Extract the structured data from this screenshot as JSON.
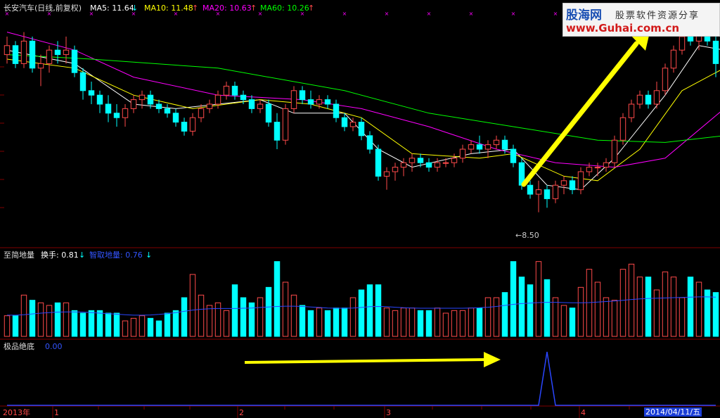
{
  "header": {
    "title": "长安汽车(日线,前复权)",
    "ma5_label": "MA5: 11.64",
    "ma5_arrow": "↓",
    "ma10_label": "MA10: 11.48",
    "ma10_arrow": "↑",
    "ma20_label": "MA20: 10.63",
    "ma20_arrow": "↑",
    "ma60_label": "MA60: 10.26",
    "ma60_arrow": "↑"
  },
  "panel2": {
    "title": "至简地量",
    "turnover_label": "换手: 0.81",
    "turnover_arrow": "↓",
    "smart_label": "智取地量: 0.76",
    "smart_arrow": "↓"
  },
  "panel3": {
    "title": "极品绝底",
    "value": "0.00"
  },
  "watermark": {
    "brand": "股海网",
    "slogan": "股票软件资源分享",
    "url": "www.Guhai.com.cn"
  },
  "low_marker": "8.50",
  "xaxis": {
    "year": "2013年",
    "m1": "1",
    "m2": "2",
    "m3": "3",
    "m4": "4",
    "date_box": "2014/04/11/五"
  },
  "colors": {
    "bg": "#000000",
    "up": "#ff4a4a",
    "down": "#00ffff",
    "ma5": "#ffffff",
    "ma10": "#ffff00",
    "ma20": "#ff00ff",
    "ma60": "#00ff00",
    "arrow": "#ffff00"
  },
  "chart_data": [
    {
      "type": "candlestick",
      "title": "长安汽车(日线,前复权)",
      "ylim": [
        8.0,
        13.0
      ],
      "series_candles": [
        [
          12.1,
          12.5,
          11.9,
          12.3
        ],
        [
          12.3,
          12.4,
          11.8,
          11.9
        ],
        [
          11.9,
          12.6,
          11.8,
          12.4
        ],
        [
          12.4,
          12.5,
          11.7,
          11.8
        ],
        [
          11.8,
          12.1,
          11.4,
          11.9
        ],
        [
          11.9,
          12.3,
          11.7,
          12.2
        ],
        [
          12.2,
          12.4,
          11.9,
          12.1
        ],
        [
          12.1,
          12.5,
          11.9,
          12.2
        ],
        [
          12.2,
          12.3,
          11.6,
          11.7
        ],
        [
          11.7,
          11.8,
          11.1,
          11.3
        ],
        [
          11.3,
          11.5,
          11.0,
          11.2
        ],
        [
          11.2,
          11.3,
          10.8,
          11.0
        ],
        [
          11.0,
          11.2,
          10.6,
          10.8
        ],
        [
          10.8,
          11.0,
          10.5,
          10.7
        ],
        [
          10.7,
          11.0,
          10.5,
          10.9
        ],
        [
          10.9,
          11.2,
          10.8,
          11.1
        ],
        [
          11.1,
          11.3,
          10.9,
          11.2
        ],
        [
          11.2,
          11.3,
          10.9,
          11.0
        ],
        [
          11.0,
          11.1,
          10.8,
          10.9
        ],
        [
          10.9,
          11.0,
          10.7,
          10.8
        ],
        [
          10.8,
          10.9,
          10.5,
          10.6
        ],
        [
          10.6,
          10.7,
          10.3,
          10.4
        ],
        [
          10.4,
          10.8,
          10.3,
          10.7
        ],
        [
          10.7,
          11.0,
          10.6,
          10.9
        ],
        [
          10.9,
          11.1,
          10.8,
          11.0
        ],
        [
          11.0,
          11.3,
          10.9,
          11.2
        ],
        [
          11.2,
          11.5,
          11.1,
          11.4
        ],
        [
          11.4,
          11.5,
          11.1,
          11.2
        ],
        [
          11.2,
          11.3,
          11.0,
          11.1
        ],
        [
          11.1,
          11.2,
          10.8,
          10.9
        ],
        [
          10.9,
          11.1,
          10.8,
          11.0
        ],
        [
          11.0,
          11.1,
          10.5,
          10.6
        ],
        [
          10.6,
          10.8,
          10.0,
          10.2
        ],
        [
          10.2,
          11.0,
          10.1,
          10.9
        ],
        [
          10.9,
          11.4,
          10.8,
          11.3
        ],
        [
          11.3,
          11.4,
          11.0,
          11.1
        ],
        [
          11.1,
          11.3,
          10.9,
          11.0
        ],
        [
          11.0,
          11.2,
          10.9,
          11.1
        ],
        [
          11.1,
          11.2,
          10.9,
          11.0
        ],
        [
          11.0,
          11.1,
          10.6,
          10.7
        ],
        [
          10.7,
          10.8,
          10.4,
          10.5
        ],
        [
          10.5,
          10.7,
          10.4,
          10.6
        ],
        [
          10.6,
          10.7,
          10.2,
          10.3
        ],
        [
          10.3,
          10.4,
          9.9,
          10.0
        ],
        [
          10.0,
          10.1,
          9.3,
          9.4
        ],
        [
          9.4,
          9.6,
          9.1,
          9.5
        ],
        [
          9.5,
          9.7,
          9.3,
          9.6
        ],
        [
          9.6,
          9.8,
          9.4,
          9.7
        ],
        [
          9.7,
          9.9,
          9.5,
          9.8
        ],
        [
          9.8,
          9.9,
          9.6,
          9.7
        ],
        [
          9.7,
          9.8,
          9.5,
          9.6
        ],
        [
          9.6,
          9.8,
          9.5,
          9.7
        ],
        [
          9.7,
          9.8,
          9.6,
          9.7
        ],
        [
          9.7,
          9.9,
          9.6,
          9.8
        ],
        [
          9.8,
          10.1,
          9.7,
          10.0
        ],
        [
          10.0,
          10.2,
          9.9,
          10.1
        ],
        [
          10.1,
          10.3,
          9.9,
          10.0
        ],
        [
          10.0,
          10.2,
          9.8,
          10.1
        ],
        [
          10.1,
          10.3,
          10.0,
          10.2
        ],
        [
          10.2,
          10.3,
          9.9,
          10.0
        ],
        [
          10.0,
          10.1,
          9.6,
          9.7
        ],
        [
          9.7,
          9.8,
          9.1,
          9.2
        ],
        [
          9.2,
          9.3,
          8.9,
          9.0
        ],
        [
          9.0,
          9.3,
          8.6,
          9.1
        ],
        [
          9.1,
          9.2,
          8.7,
          8.9
        ],
        [
          8.9,
          9.3,
          8.8,
          9.2
        ],
        [
          9.2,
          9.4,
          9.0,
          9.3
        ],
        [
          9.3,
          9.4,
          9.0,
          9.1
        ],
        [
          9.1,
          9.6,
          9.0,
          9.5
        ],
        [
          9.5,
          9.7,
          9.4,
          9.6
        ],
        [
          9.6,
          9.7,
          9.4,
          9.6
        ],
        [
          9.6,
          9.8,
          9.5,
          9.7
        ],
        [
          9.7,
          10.3,
          9.6,
          10.2
        ],
        [
          10.2,
          10.8,
          10.1,
          10.7
        ],
        [
          10.7,
          11.1,
          10.6,
          11.0
        ],
        [
          11.0,
          11.3,
          10.9,
          11.2
        ],
        [
          11.2,
          11.3,
          10.9,
          11.0
        ],
        [
          11.0,
          11.5,
          10.9,
          11.3
        ],
        [
          11.3,
          11.9,
          11.2,
          11.8
        ],
        [
          11.8,
          12.3,
          11.7,
          12.2
        ],
        [
          12.2,
          12.6,
          12.1,
          12.5
        ],
        [
          12.5,
          12.9,
          12.3,
          12.4
        ],
        [
          12.4,
          12.8,
          12.2,
          12.6
        ],
        [
          12.6,
          12.8,
          12.3,
          12.4
        ],
        [
          12.4,
          12.6,
          11.6,
          11.9
        ]
      ],
      "ma_series": [
        {
          "name": "MA5",
          "anchors": [
            [
              0,
              12.2
            ],
            [
              8,
              11.9
            ],
            [
              15,
              11.0
            ],
            [
              20,
              10.9
            ],
            [
              25,
              11.0
            ],
            [
              30,
              11.1
            ],
            [
              34,
              10.8
            ],
            [
              40,
              10.8
            ],
            [
              44,
              10.0
            ],
            [
              48,
              9.6
            ],
            [
              55,
              9.9
            ],
            [
              60,
              10.0
            ],
            [
              64,
              9.2
            ],
            [
              68,
              9.1
            ],
            [
              72,
              9.8
            ],
            [
              78,
              11.2
            ],
            [
              82,
              12.3
            ],
            [
              85,
              12.2
            ]
          ]
        },
        {
          "name": "MA10",
          "anchors": [
            [
              0,
              12.0
            ],
            [
              8,
              11.8
            ],
            [
              15,
              11.2
            ],
            [
              22,
              10.9
            ],
            [
              30,
              11.1
            ],
            [
              36,
              11.0
            ],
            [
              42,
              10.7
            ],
            [
              48,
              9.9
            ],
            [
              56,
              9.8
            ],
            [
              60,
              9.9
            ],
            [
              66,
              9.4
            ],
            [
              70,
              9.3
            ],
            [
              75,
              10.0
            ],
            [
              80,
              11.3
            ],
            [
              85,
              11.8
            ]
          ]
        },
        {
          "name": "MA20",
          "anchors": [
            [
              0,
              12.6
            ],
            [
              8,
              12.2
            ],
            [
              15,
              11.6
            ],
            [
              25,
              11.2
            ],
            [
              35,
              11.1
            ],
            [
              42,
              10.9
            ],
            [
              50,
              10.5
            ],
            [
              58,
              10.0
            ],
            [
              65,
              9.7
            ],
            [
              72,
              9.6
            ],
            [
              78,
              9.8
            ],
            [
              85,
              10.9
            ]
          ]
        },
        {
          "name": "MA60",
          "anchors": [
            [
              0,
              12.1
            ],
            [
              10,
              12.0
            ],
            [
              25,
              11.8
            ],
            [
              40,
              11.3
            ],
            [
              50,
              10.8
            ],
            [
              60,
              10.5
            ],
            [
              70,
              10.2
            ],
            [
              78,
              10.15
            ],
            [
              85,
              10.3
            ]
          ]
        }
      ],
      "annotation": {
        "label": "8.50",
        "value": 8.5
      }
    },
    {
      "type": "bar",
      "title": "至简地量",
      "series": [
        {
          "name": "换手",
          "values": [
            0.8,
            0.8,
            1.6,
            1.4,
            1.3,
            1.2,
            1.3,
            1.3,
            1.0,
            0.9,
            1.0,
            1.0,
            0.9,
            0.9,
            0.6,
            0.7,
            0.8,
            0.7,
            0.6,
            0.9,
            1.0,
            1.5,
            2.4,
            1.6,
            1.2,
            1.3,
            1.0,
            2.0,
            1.5,
            1.3,
            1.5,
            1.9,
            2.9,
            2.1,
            1.6,
            1.2,
            1.0,
            1.1,
            1.0,
            1.1,
            1.1,
            1.5,
            1.8,
            2.0,
            2.0,
            1.1,
            1.0,
            1.1,
            1.1,
            1.0,
            1.0,
            1.1,
            0.9,
            1.0,
            1.0,
            1.1,
            1.1,
            1.5,
            1.5,
            1.7,
            2.9,
            2.3,
            2.0,
            2.9,
            2.2,
            1.5,
            1.2,
            1.1,
            1.9,
            2.6,
            2.1,
            1.5,
            1.4,
            2.6,
            2.8,
            2.3,
            2.3,
            1.8,
            2.5,
            2.3,
            1.5,
            2.3,
            2.1,
            1.8,
            1.7
          ]
        },
        {
          "name": "智取地量",
          "values": [
            0.82,
            0.82,
            0.84,
            0.87,
            0.9,
            0.92,
            0.94,
            0.95,
            0.95,
            0.94,
            0.92,
            0.9,
            0.88,
            0.86,
            0.84,
            0.82,
            0.82,
            0.83,
            0.85,
            0.88,
            0.92,
            0.97,
            1.02,
            1.05,
            1.07,
            1.08,
            1.08,
            1.08,
            1.09,
            1.1,
            1.12,
            1.14,
            1.16,
            1.17,
            1.17,
            1.16,
            1.14,
            1.12,
            1.1,
            1.09,
            1.09,
            1.1,
            1.12,
            1.15,
            1.16,
            1.15,
            1.13,
            1.11,
            1.1,
            1.09,
            1.09,
            1.09,
            1.09,
            1.09,
            1.09,
            1.1,
            1.11,
            1.13,
            1.16,
            1.2,
            1.24,
            1.27,
            1.29,
            1.31,
            1.32,
            1.32,
            1.31,
            1.3,
            1.3,
            1.31,
            1.33,
            1.35,
            1.37,
            1.4,
            1.43,
            1.45,
            1.47,
            1.48,
            1.49,
            1.5,
            1.51,
            1.52,
            1.53,
            1.53,
            1.52
          ]
        }
      ]
    },
    {
      "type": "line",
      "title": "极品绝底",
      "series": [
        {
          "name": "极品绝底",
          "values": [
            0,
            0,
            0,
            0,
            0,
            0,
            0,
            0,
            0,
            0,
            0,
            0,
            0,
            0,
            0,
            0,
            0,
            0,
            0,
            0,
            0,
            0,
            0,
            0,
            0,
            0,
            0,
            0,
            0,
            0,
            0,
            0,
            0,
            0,
            0,
            0,
            0,
            0,
            0,
            0,
            0,
            0,
            0,
            0,
            0,
            0,
            0,
            0,
            0,
            0,
            0,
            0,
            0,
            0,
            0,
            0,
            0,
            0,
            0,
            0,
            0,
            0,
            0,
            0,
            1,
            0,
            0,
            0,
            0,
            0,
            0,
            0,
            0,
            0,
            0,
            0,
            0,
            0,
            0,
            0,
            0,
            0,
            0,
            0,
            0
          ]
        }
      ]
    }
  ]
}
